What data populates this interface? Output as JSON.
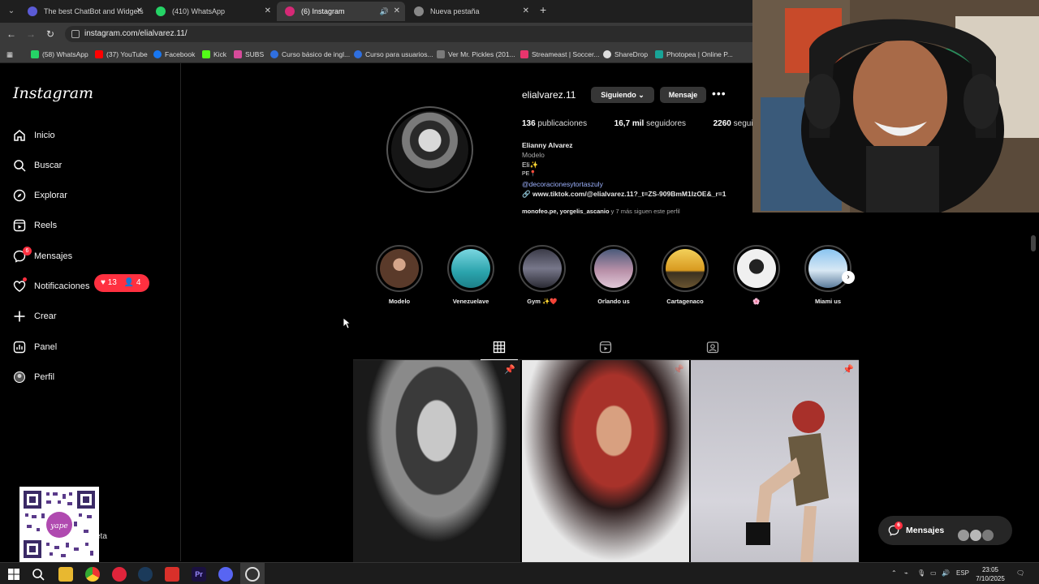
{
  "browser": {
    "tabs": [
      {
        "title": "The best ChatBot and Widgets",
        "active": false
      },
      {
        "title": "(410) WhatsApp",
        "active": false
      },
      {
        "title": "(6) Instagram",
        "active": true
      },
      {
        "title": "Nueva pestaña",
        "active": false
      }
    ],
    "url": "instagram.com/elialvarez.11/",
    "bookmarks": [
      {
        "label": "(58) WhatsApp",
        "color": "#25d366"
      },
      {
        "label": "(37) YouTube",
        "color": "#ff0000"
      },
      {
        "label": "Facebook",
        "color": "#1877f2"
      },
      {
        "label": "Kick",
        "color": "#53fc18"
      },
      {
        "label": "SUBS",
        "color": "#d64b9a"
      },
      {
        "label": "Curso básico de ingl...",
        "color": "#2f6fdf"
      },
      {
        "label": "Curso para usuarios...",
        "color": "#2f6fdf"
      },
      {
        "label": "Ver Mr. Pickles (201...",
        "color": "#7a7a7a"
      },
      {
        "label": "Streameast | Soccer...",
        "color": "#e8356d"
      },
      {
        "label": "ShareDrop",
        "color": "#dddddd"
      },
      {
        "label": "Photopea | Online P...",
        "color": "#18a497"
      }
    ]
  },
  "sidebar": {
    "logo": "Instagram",
    "items": [
      {
        "label": "Inicio",
        "icon": "home-icon"
      },
      {
        "label": "Buscar",
        "icon": "search-icon"
      },
      {
        "label": "Explorar",
        "icon": "compass-icon"
      },
      {
        "label": "Reels",
        "icon": "reels-icon"
      },
      {
        "label": "Mensajes",
        "icon": "messenger-icon",
        "badge": "6"
      },
      {
        "label": "Notificaciones",
        "icon": "heart-icon"
      },
      {
        "label": "Crear",
        "icon": "plus-icon"
      },
      {
        "label": "Panel",
        "icon": "chart-icon"
      },
      {
        "label": "Perfil",
        "icon": "avatar-icon"
      }
    ],
    "notification_likes": "13",
    "notification_follows": "4",
    "more_label": "eta"
  },
  "profile": {
    "username": "elialvarez.11",
    "follow_button": "Siguiendo",
    "message_button": "Mensaje",
    "posts_count": "136",
    "posts_label": "publicaciones",
    "followers_count": "16,7 mil",
    "followers_label": "seguidores",
    "following_count": "2260",
    "following_label": "seguidos",
    "name": "Elianny Alvarez",
    "category": "Modelo",
    "bio_line1": "Eli✨",
    "bio_line2": "PE📍",
    "mention": "@decoracionesytortaszuly",
    "external_link": "www.tiktok.com/@elialvarez.11?_t=ZS-909BmM1IzOE&_r=1",
    "followed_by_names": "monofeo.pe, yorgelis_ascanio",
    "followed_by_more": " y 7 más siguen este perfil"
  },
  "highlights": [
    {
      "label": "Modelo",
      "color": "#7a4a3a"
    },
    {
      "label": "Venezuelave",
      "color": "#3fbcc0"
    },
    {
      "label": "Gym ✨❤️",
      "color": "#555566"
    },
    {
      "label": "Orlando us",
      "color": "#8a7a9a"
    },
    {
      "label": "Cartagenaco",
      "color": "#d8a030"
    },
    {
      "label": "🌸",
      "color": "#d0d0d0"
    },
    {
      "label": "Miami us",
      "color": "#6aa5d8"
    }
  ],
  "taskbar": {
    "language": "ESP",
    "time": "23:05",
    "date": "7/10/2025"
  },
  "floater": {
    "messages_label": "Mensajes",
    "messages_badge": "6"
  }
}
